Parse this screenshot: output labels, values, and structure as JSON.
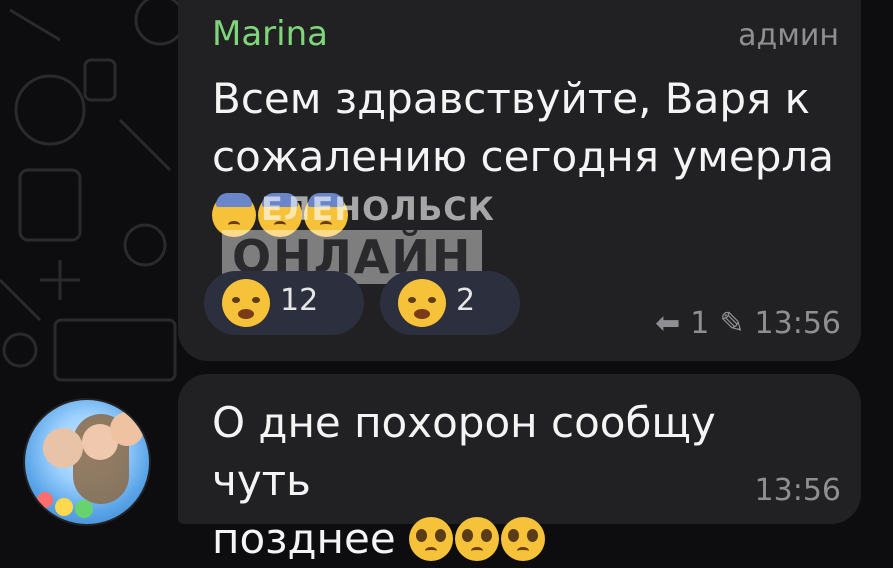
{
  "messages": [
    {
      "author": "Marina",
      "role": "админ",
      "text_line1": "Всем здравствуйте, Варя к",
      "text_line2": "сожалению сегодня умерла",
      "watermark_top": "ЕЛЕНОЛЬСК",
      "watermark_main": "ОНЛАЙН",
      "reactions": [
        {
          "icon": "loudly-crying-face-icon",
          "count": "12"
        },
        {
          "icon": "crying-face-icon",
          "count": "2"
        }
      ],
      "replies": "1",
      "time": "13:56"
    },
    {
      "text_line1": "О дне похорон сообщу чуть",
      "text_line2": "позднее",
      "time": "13:56"
    }
  ]
}
